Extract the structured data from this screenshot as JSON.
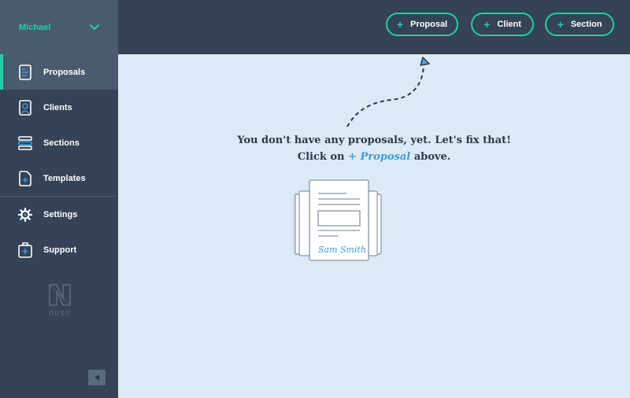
{
  "user": {
    "name": "Michael"
  },
  "sidebar": {
    "items": [
      {
        "label": "Proposals",
        "icon": "proposal-doc-icon",
        "active": true
      },
      {
        "label": "Clients",
        "icon": "client-badge-icon",
        "active": false
      },
      {
        "label": "Sections",
        "icon": "sections-stack-icon",
        "active": false
      },
      {
        "label": "Templates",
        "icon": "template-doc-icon",
        "active": false
      },
      {
        "label": "Settings",
        "icon": "gear-icon",
        "active": false
      },
      {
        "label": "Support",
        "icon": "first-aid-kit-icon",
        "active": false
      }
    ],
    "logo_text": "nusii"
  },
  "toolbar": {
    "proposal_label": "Proposal",
    "client_label": "Client",
    "section_label": "Section"
  },
  "empty_state": {
    "line1": "You don't have any proposals, yet. Let's fix that!",
    "click_on": "Click on",
    "link_text": "+ Proposal",
    "above": "above.",
    "signature": "Sam Smith"
  },
  "colors": {
    "accent": "#1fd1a8",
    "sidebar_bg": "#344355",
    "active_bg": "#4a5b70",
    "content_bg": "#dbeaf5",
    "link": "#3d9be0"
  }
}
